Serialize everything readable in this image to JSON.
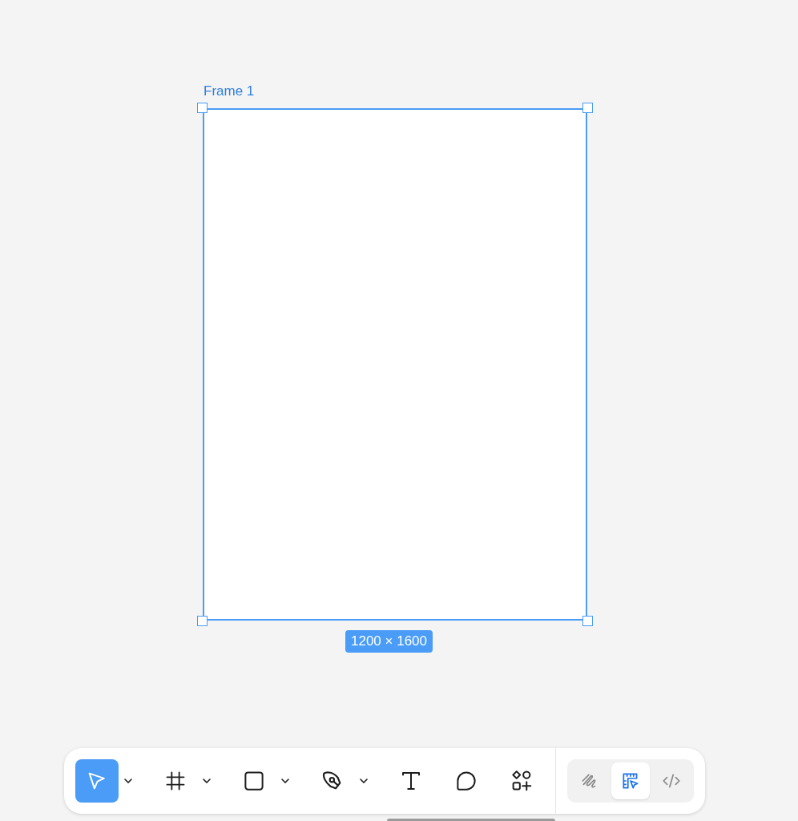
{
  "frame": {
    "label": "Frame 1",
    "size": "1200 × 1600",
    "selected": true
  },
  "tools": [
    {
      "kind": "select",
      "selected": true,
      "has_menu": true
    },
    {
      "kind": "frame",
      "selected": false,
      "has_menu": true
    },
    {
      "kind": "rectangle",
      "selected": false,
      "has_menu": true
    },
    {
      "kind": "pen",
      "selected": false,
      "has_menu": true
    },
    {
      "kind": "text",
      "selected": false,
      "has_menu": false
    },
    {
      "kind": "comment",
      "selected": false,
      "has_menu": false
    },
    {
      "kind": "components",
      "selected": false,
      "has_menu": false
    }
  ],
  "modes": [
    {
      "kind": "draw",
      "selected": false
    },
    {
      "kind": "design",
      "selected": true
    },
    {
      "kind": "dev",
      "selected": false
    }
  ]
}
